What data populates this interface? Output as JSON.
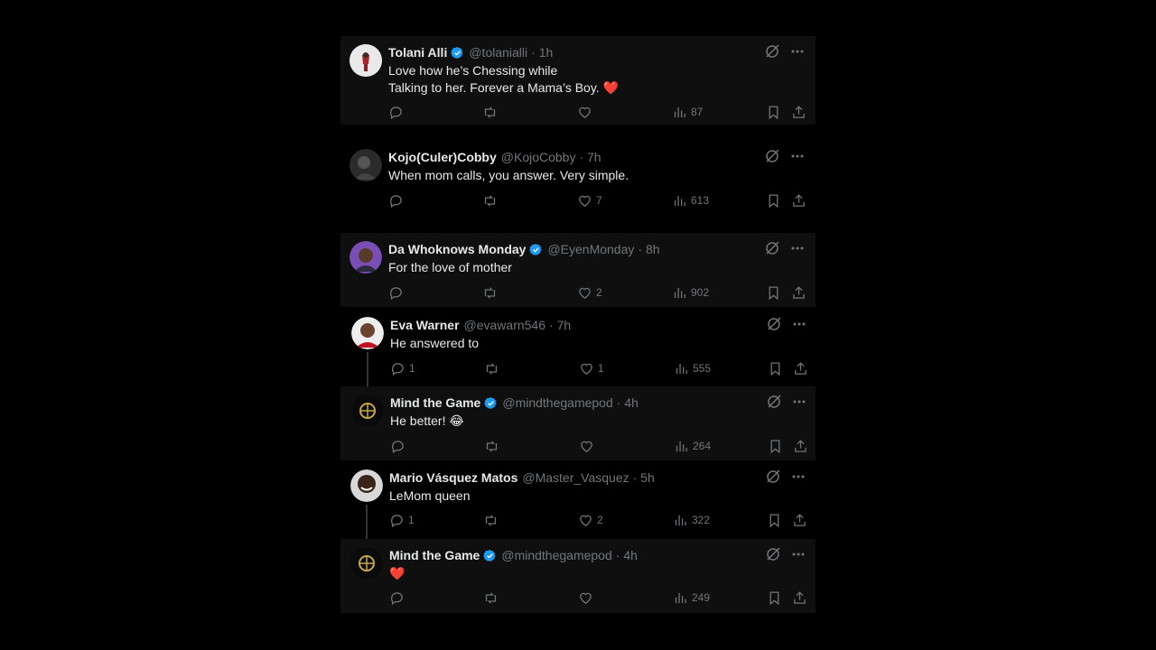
{
  "tweets": [
    {
      "name": "Tolani Alli",
      "verified": true,
      "handle": "@tolanialli",
      "time": "· 1h",
      "lines": [
        "Love how he’s Chessing while",
        "Talking to her. Forever a Mama’s Boy. ❤️"
      ],
      "replies": "",
      "likes": "",
      "views": "87",
      "highlight": true,
      "avatar": "light"
    },
    {
      "name": "Kojo(Culer)Cobby",
      "verified": false,
      "handle": "@KojoCobby",
      "time": "· 7h",
      "lines": [
        "When mom calls, you answer. Very simple."
      ],
      "replies": "",
      "likes": "7",
      "views": "613",
      "highlight": false,
      "avatar": "dark"
    },
    {
      "name": "Da Whoknows Monday",
      "verified": true,
      "handle": "@EyenMonday",
      "time": "· 8h",
      "lines": [
        "For the love of mother"
      ],
      "replies": "",
      "likes": "2",
      "views": "902",
      "highlight": true,
      "avatar": "purple"
    },
    {
      "name": "Eva Warner",
      "verified": false,
      "handle": "@evawarn546",
      "time": "· 7h",
      "lines": [
        "He answered to"
      ],
      "replies": "1",
      "likes": "1",
      "views": "555",
      "highlight": false,
      "avatar": "red"
    },
    {
      "name": "Mind the Game",
      "verified": true,
      "handle": "@mindthegamepod",
      "time": "· 4h",
      "lines": [
        "He better! 😂"
      ],
      "replies": "",
      "likes": "",
      "views": "264",
      "highlight": true,
      "avatar": "logo"
    },
    {
      "name": "Mario Vásquez Matos",
      "verified": false,
      "handle": "@Master_Vasquez",
      "time": "· 5h",
      "lines": [
        "LeMom queen"
      ],
      "replies": "1",
      "likes": "2",
      "views": "322",
      "highlight": false,
      "avatar": "face"
    },
    {
      "name": "Mind the Game",
      "verified": true,
      "handle": "@mindthegamepod",
      "time": "· 4h",
      "lines": [
        "❤️"
      ],
      "replies": "",
      "likes": "",
      "views": "249",
      "highlight": true,
      "avatar": "logo"
    }
  ],
  "colors": {
    "verified": "#1d9bf0",
    "muted": "#71767b",
    "heart": "#f4212e",
    "text": "#e7e9ea"
  },
  "icons": [
    "grok-icon",
    "more-icon",
    "reply-icon",
    "retweet-icon",
    "like-icon",
    "views-icon",
    "bookmark-icon",
    "share-icon",
    "verified-badge-icon"
  ]
}
